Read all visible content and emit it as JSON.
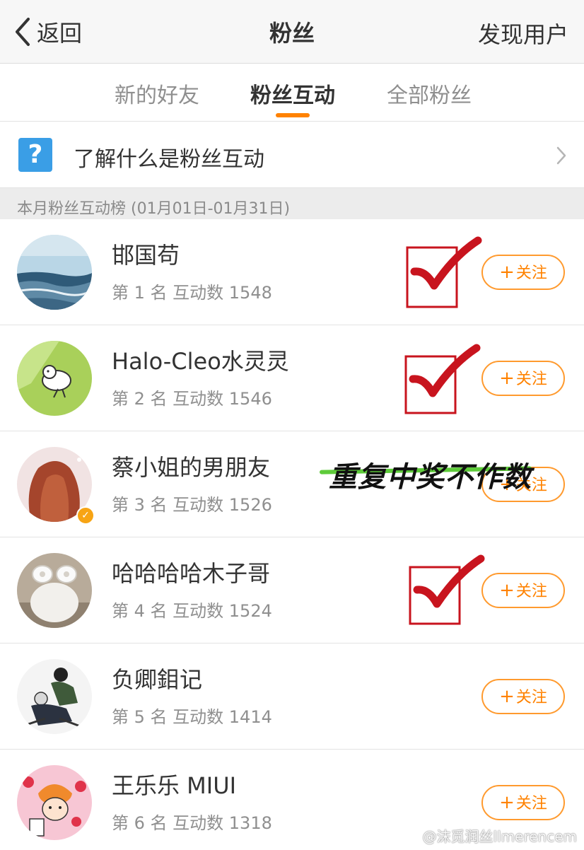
{
  "navbar": {
    "back_label": "返回",
    "title": "粉丝",
    "right_action": "发现用户"
  },
  "tabs": [
    {
      "label": "新的好友",
      "active": false
    },
    {
      "label": "粉丝互动",
      "active": true
    },
    {
      "label": "全部粉丝",
      "active": false
    }
  ],
  "info": {
    "icon": "question-icon",
    "icon_glyph": "?",
    "label": "了解什么是粉丝互动"
  },
  "section": {
    "label": "本月粉丝互动榜 (01月01日-01月31日)"
  },
  "fans": [
    {
      "name": "邯国苟",
      "rank": "第 1 名  互动数 1548",
      "follow": "关注",
      "checked": true,
      "verified": false
    },
    {
      "name": "Halo-Cleo水灵灵",
      "rank": "第 2 名  互动数 1546",
      "follow": "关注",
      "checked": true,
      "verified": false
    },
    {
      "name": "蔡小姐的男朋友",
      "rank": "第 3 名  互动数 1526",
      "follow": "关注",
      "checked": false,
      "verified": true,
      "note": "重复中奖不作数"
    },
    {
      "name": "哈哈哈哈木子哥",
      "rank": "第 4 名  互动数 1524",
      "follow": "关注",
      "checked": true,
      "verified": false
    },
    {
      "name": "负卿鉬记",
      "rank": "第 5 名  互动数 1414",
      "follow": "关注",
      "checked": false,
      "verified": false
    },
    {
      "name": "王乐乐 MIUI",
      "rank": "第 6 名  互动数 1318",
      "follow": "关注",
      "checked": false,
      "verified": false
    }
  ],
  "follow_plus": "+",
  "watermark": "@沫觅润丝llmerencem",
  "colors": {
    "accent": "#ff8200",
    "help_blue": "#3a9ee6",
    "check_red": "#c8141e",
    "strike_green": "#5ecb3a"
  }
}
